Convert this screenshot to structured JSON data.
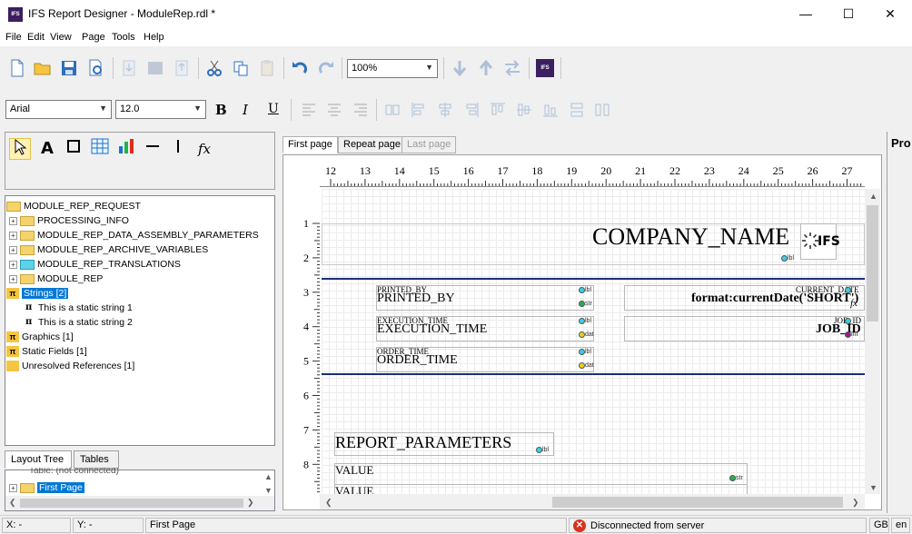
{
  "window": {
    "title": "IFS Report Designer - ModuleRep.rdl *",
    "app_icon_text": "IFS",
    "minimize": "—",
    "maximize": "☐",
    "close": "✕"
  },
  "menu": [
    "File",
    "Edit",
    "View",
    "Page",
    "Tools",
    "Help"
  ],
  "toolbar": {
    "zoom_value": "100%"
  },
  "format_bar": {
    "font_value": "Arial",
    "size_value": "12.0",
    "bold": "B",
    "italic": "I",
    "underline": "U"
  },
  "tools": {
    "text_tool": "A",
    "fx_tool": "fx"
  },
  "tree": {
    "items": [
      {
        "label": "MODULE_REP_REQUEST"
      },
      {
        "label": "PROCESSING_INFO"
      },
      {
        "label": "MODULE_REP_DATA_ASSEMBLY_PARAMETERS"
      },
      {
        "label": "MODULE_REP_ARCHIVE_VARIABLES"
      },
      {
        "label": "MODULE_REP_TRANSLATIONS"
      },
      {
        "label": "MODULE_REP"
      },
      {
        "label": "Strings [2]"
      },
      {
        "label": "This is a static string 1"
      },
      {
        "label": "This is a static string 2"
      },
      {
        "label": "Graphics [1]"
      },
      {
        "label": "Static Fields [1]"
      },
      {
        "label": "Unresolved References [1]"
      }
    ]
  },
  "bottom_tabs": [
    "Layout Tree",
    "Tables"
  ],
  "layout_tree": {
    "partial_item": "Table: (not connected)",
    "selected_item": "First Page"
  },
  "doc_tabs": [
    "First page",
    "Repeat page",
    "Last page"
  ],
  "ruler": {
    "h": [
      "12",
      "13",
      "14",
      "15",
      "16",
      "17",
      "18",
      "19",
      "20",
      "21",
      "22",
      "23",
      "24",
      "25",
      "26",
      "27"
    ],
    "v": [
      "1",
      "2",
      "3",
      "4",
      "5",
      "6",
      "7",
      "8"
    ]
  },
  "report": {
    "company_name": "COMPANY_NAME",
    "logo_text": "IFS",
    "printed_by_label": "PRINTED_BY",
    "printed_by_value": "PRINTED_BY",
    "execution_time_label": "EXECUTION_TIME",
    "execution_time_value": "EXECUTION_TIME",
    "order_time_label": "ORDER_TIME",
    "order_time_value": "ORDER_TIME",
    "current_date_label": "CURRENT_DATE",
    "current_date_value": "format:currentDate('SHORT')",
    "job_id_label": "JOB_ID",
    "job_id_value": "JOB_ID",
    "report_parameters": "REPORT_PARAMETERS",
    "value1": "VALUE",
    "value2": "VALUE",
    "tag_lbl": "lbl",
    "tag_str": "str",
    "tag_dat": "dat",
    "tag_int": "int",
    "fx_mark": "fx"
  },
  "properties": {
    "label": "Pro"
  },
  "status": {
    "x": "X: -",
    "y": "Y: -",
    "page": "First Page",
    "connection": "Disconnected from server",
    "region": "GB",
    "lang": "en"
  },
  "colors": {
    "selection": "#0078d7",
    "band_line": "#1a2d7a",
    "dot_cyan": "#37d0e6",
    "dot_green": "#22b14c",
    "dot_yellow": "#e8d21e",
    "dot_purple": "#a0198c",
    "error": "#d9301e"
  }
}
